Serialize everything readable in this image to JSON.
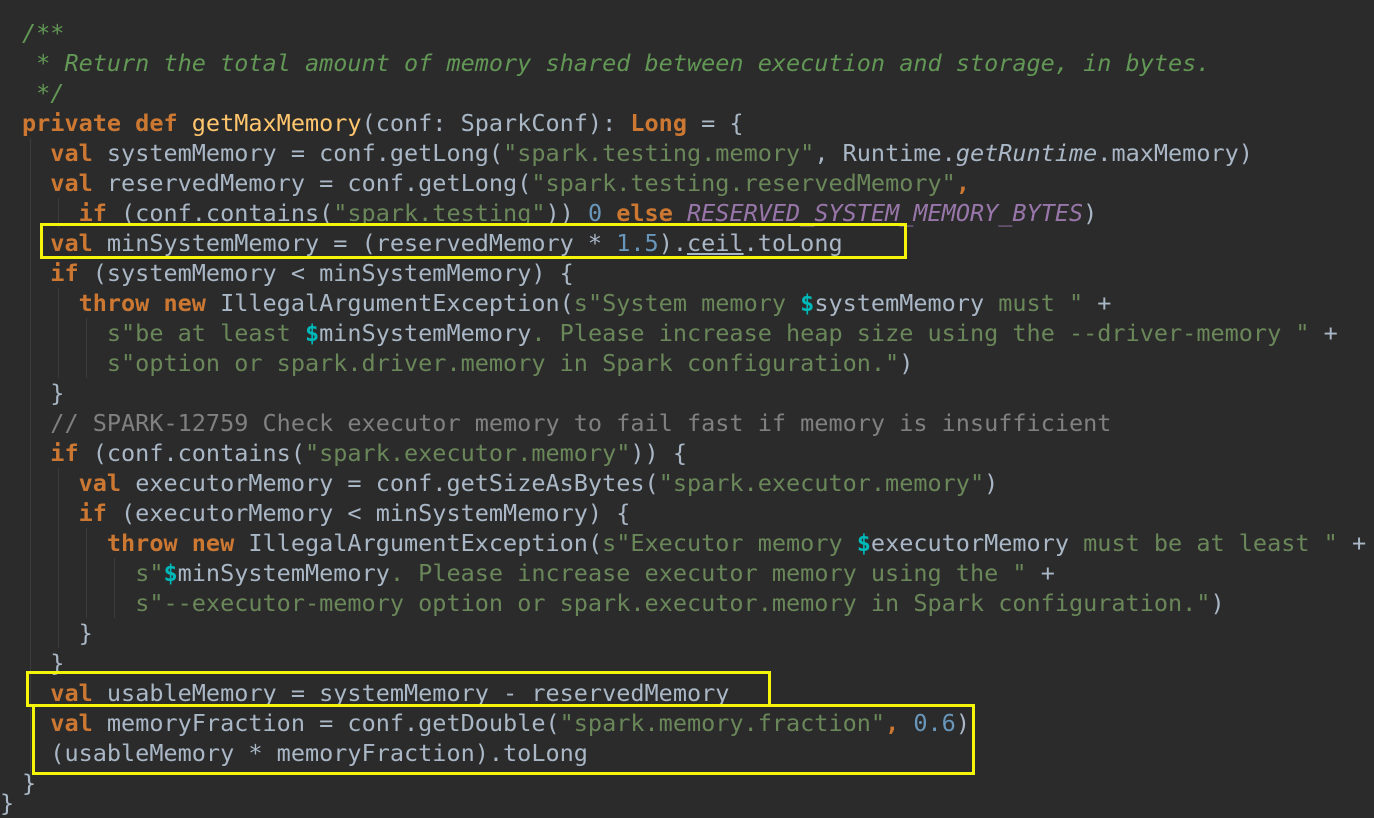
{
  "editor": {
    "lines": [
      [
        {
          "t": "/**",
          "c": "doc"
        }
      ],
      [
        {
          "t": " * Return the total amount of memory shared between execution and storage, in bytes.",
          "c": "doc"
        }
      ],
      [
        {
          "t": " */",
          "c": "doc"
        }
      ],
      [
        {
          "t": "private def ",
          "c": "kw"
        },
        {
          "t": "getMaxMemory",
          "c": "fn"
        },
        {
          "t": "(conf: SparkConf): ",
          "c": ""
        },
        {
          "t": "Long",
          "c": "kw"
        },
        {
          "t": " = {",
          "c": ""
        }
      ],
      [
        {
          "t": "  ",
          "c": ""
        },
        {
          "t": "val",
          "c": "kw"
        },
        {
          "t": " systemMemory = conf.getLong(",
          "c": ""
        },
        {
          "t": "\"spark.testing.memory\"",
          "c": "str"
        },
        {
          "t": ", Runtime.",
          "c": ""
        },
        {
          "t": "getRuntime",
          "c": "ital"
        },
        {
          "t": ".maxMemory)",
          "c": ""
        }
      ],
      [
        {
          "t": "  ",
          "c": ""
        },
        {
          "t": "val",
          "c": "kw"
        },
        {
          "t": " reservedMemory = conf.getLong(",
          "c": ""
        },
        {
          "t": "\"spark.testing.reservedMemory\"",
          "c": "str"
        },
        {
          "t": ",",
          "c": "kw"
        }
      ],
      [
        {
          "t": "    ",
          "c": ""
        },
        {
          "t": "if",
          "c": "kw"
        },
        {
          "t": " (conf.contains(",
          "c": ""
        },
        {
          "t": "\"spark.testing\"",
          "c": "str"
        },
        {
          "t": ")) ",
          "c": ""
        },
        {
          "t": "0",
          "c": "num"
        },
        {
          "t": " ",
          "c": ""
        },
        {
          "t": "else",
          "c": "kw"
        },
        {
          "t": " ",
          "c": ""
        },
        {
          "t": "RESERVED_SYSTEM_MEMORY_BYTES",
          "c": "const"
        },
        {
          "t": ")",
          "c": ""
        }
      ],
      [
        {
          "t": "  ",
          "c": ""
        },
        {
          "t": "val",
          "c": "kw"
        },
        {
          "t": " minSystemMemory = (reservedMemory * ",
          "c": ""
        },
        {
          "t": "1.5",
          "c": "num"
        },
        {
          "t": ").",
          "c": ""
        },
        {
          "t": "ceil",
          "c": "ul"
        },
        {
          "t": ".toLong",
          "c": ""
        }
      ],
      [
        {
          "t": "  ",
          "c": ""
        },
        {
          "t": "if",
          "c": "kw"
        },
        {
          "t": " (systemMemory < minSystemMemory) {",
          "c": ""
        }
      ],
      [
        {
          "t": "    ",
          "c": ""
        },
        {
          "t": "throw new",
          "c": "kw"
        },
        {
          "t": " IllegalArgumentException(",
          "c": ""
        },
        {
          "t": "s\"System memory ",
          "c": "str"
        },
        {
          "t": "$",
          "c": "interp"
        },
        {
          "t": "systemMemory",
          "c": ""
        },
        {
          "t": " must \"",
          "c": "str"
        },
        {
          "t": " +",
          "c": ""
        }
      ],
      [
        {
          "t": "      ",
          "c": ""
        },
        {
          "t": "s\"be at least ",
          "c": "str"
        },
        {
          "t": "$",
          "c": "interp"
        },
        {
          "t": "minSystemMemory",
          "c": ""
        },
        {
          "t": ". Please increase heap size using the --driver-memory \"",
          "c": "str"
        },
        {
          "t": " +",
          "c": ""
        }
      ],
      [
        {
          "t": "      ",
          "c": ""
        },
        {
          "t": "s\"option or spark.driver.memory in Spark configuration.\"",
          "c": "str"
        },
        {
          "t": ")",
          "c": ""
        }
      ],
      [
        {
          "t": "  }",
          "c": ""
        }
      ],
      [
        {
          "t": "  // SPARK-12759 Check executor memory to fail fast if memory is insufficient",
          "c": "cmt"
        }
      ],
      [
        {
          "t": "  ",
          "c": ""
        },
        {
          "t": "if",
          "c": "kw"
        },
        {
          "t": " (conf.contains(",
          "c": ""
        },
        {
          "t": "\"spark.executor.memory\"",
          "c": "str"
        },
        {
          "t": ")) {",
          "c": ""
        }
      ],
      [
        {
          "t": "    ",
          "c": ""
        },
        {
          "t": "val",
          "c": "kw"
        },
        {
          "t": " executorMemory = conf.getSizeAsBytes(",
          "c": ""
        },
        {
          "t": "\"spark.executor.memory\"",
          "c": "str"
        },
        {
          "t": ")",
          "c": ""
        }
      ],
      [
        {
          "t": "    ",
          "c": ""
        },
        {
          "t": "if",
          "c": "kw"
        },
        {
          "t": " (executorMemory < minSystemMemory) {",
          "c": ""
        }
      ],
      [
        {
          "t": "      ",
          "c": ""
        },
        {
          "t": "throw new",
          "c": "kw"
        },
        {
          "t": " IllegalArgumentException(",
          "c": ""
        },
        {
          "t": "s\"Executor memory ",
          "c": "str"
        },
        {
          "t": "$",
          "c": "interp"
        },
        {
          "t": "executorMemory",
          "c": ""
        },
        {
          "t": " must be at least \"",
          "c": "str"
        },
        {
          "t": " +",
          "c": ""
        }
      ],
      [
        {
          "t": "        ",
          "c": ""
        },
        {
          "t": "s\"",
          "c": "str"
        },
        {
          "t": "$",
          "c": "interp"
        },
        {
          "t": "minSystemMemory",
          "c": ""
        },
        {
          "t": ". Please increase executor memory using the \"",
          "c": "str"
        },
        {
          "t": " +",
          "c": ""
        }
      ],
      [
        {
          "t": "        ",
          "c": ""
        },
        {
          "t": "s\"--executor-memory option or spark.executor.memory in Spark configuration.\"",
          "c": "str"
        },
        {
          "t": ")",
          "c": ""
        }
      ],
      [
        {
          "t": "    }",
          "c": ""
        }
      ],
      [
        {
          "t": "  }",
          "c": ""
        }
      ],
      [
        {
          "t": "  ",
          "c": ""
        },
        {
          "t": "val",
          "c": "kw"
        },
        {
          "t": " usableMemory = systemMemory - reservedMemory",
          "c": ""
        }
      ],
      [
        {
          "t": "  ",
          "c": ""
        },
        {
          "t": "val",
          "c": "kw"
        },
        {
          "t": " memoryFraction = conf.getDouble(",
          "c": ""
        },
        {
          "t": "\"spark.memory.fraction\"",
          "c": "str"
        },
        {
          "t": ", ",
          "c": "kw"
        },
        {
          "t": "0.6",
          "c": "num"
        },
        {
          "t": ")",
          "c": ""
        }
      ],
      [
        {
          "t": "  (usableMemory * memoryFraction).toLong",
          "c": ""
        }
      ],
      [
        {
          "t": "}",
          "c": ""
        }
      ],
      [
        {
          "t": "}",
          "c": ""
        }
      ]
    ],
    "highlight_color": "#f5f50a"
  }
}
